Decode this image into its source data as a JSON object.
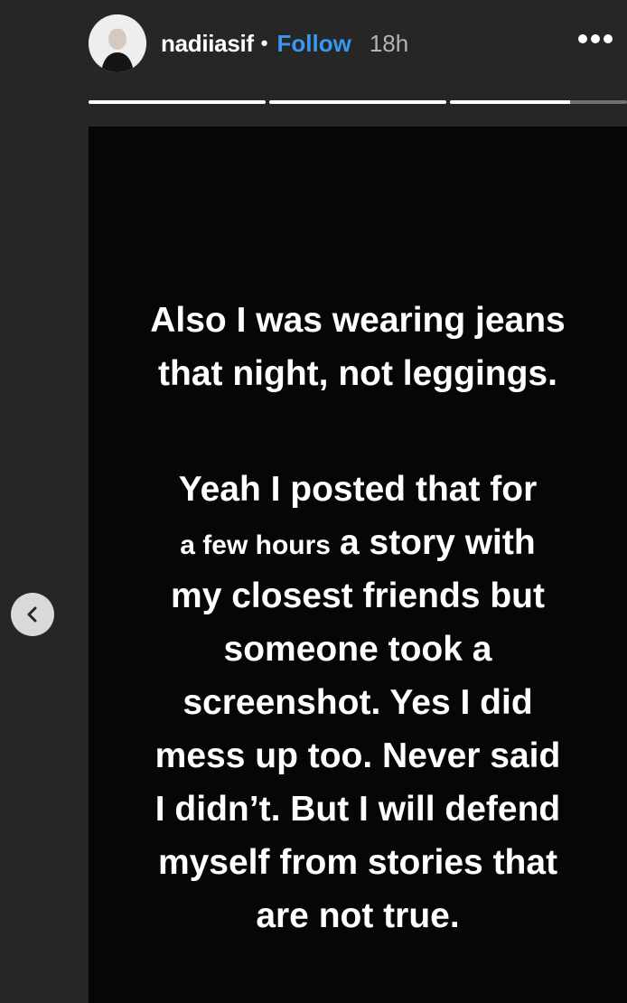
{
  "header": {
    "username": "nadiiasif",
    "separator": "•",
    "follow_label": "Follow",
    "time": "18h",
    "more_icon": "more-horizontal-icon"
  },
  "progress": {
    "segments": [
      1,
      1,
      0.68
    ]
  },
  "story": {
    "paragraph1": [
      "Also I was wearing jeans",
      "that night, not leggings."
    ],
    "paragraph2": {
      "line1": "Yeah I posted that for",
      "line2_small": "a few hours",
      "line2_rest": "a story with",
      "lines_rest": [
        "my closest friends but",
        "someone took a",
        "screenshot. Yes I did",
        "mess up too. Never said",
        "I didn’t. But I will defend",
        "myself from stories that",
        "are not true."
      ]
    }
  },
  "nav": {
    "prev_icon": "chevron-left-icon"
  },
  "colors": {
    "background": "#262626",
    "story_background": "#060606",
    "follow": "#3897f0",
    "time": "#b3b3b3"
  }
}
